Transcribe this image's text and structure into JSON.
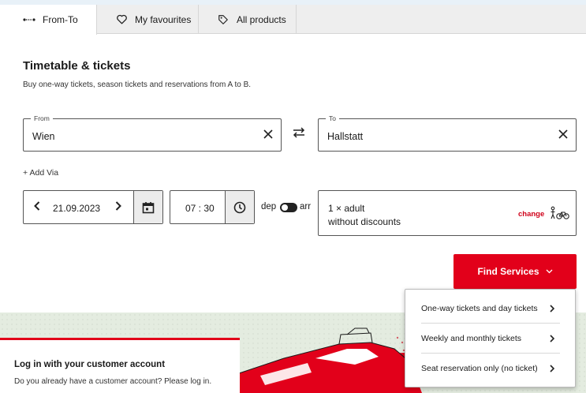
{
  "tabs": [
    {
      "label": "From-To",
      "icon": "route-dots-icon",
      "active": true
    },
    {
      "label": "My favourites",
      "icon": "heart-icon",
      "active": false
    },
    {
      "label": "All products",
      "icon": "tag-icon",
      "active": false
    }
  ],
  "heading": "Timetable & tickets",
  "subheading": "Buy one-way tickets, season tickets and reservations from A to B.",
  "from": {
    "legend": "From",
    "value": "Wien"
  },
  "to": {
    "legend": "To",
    "value": "Hallstatt"
  },
  "add_via": "+ Add Via",
  "date": {
    "value": "21.09.2023"
  },
  "time": {
    "value": "07 : 30"
  },
  "dep_label": "dep",
  "arr_label": "arr",
  "passengers": {
    "line1": "1 × adult",
    "line2": "without discounts",
    "change_label": "change"
  },
  "find_button": "Find Services",
  "login": {
    "title": "Log in with your customer account",
    "text": "Do you already have a customer account? Please log in."
  },
  "dropdown": [
    {
      "label": "One-way tickets and day tickets"
    },
    {
      "label": "Weekly and monthly tickets"
    },
    {
      "label": "Seat reservation only (no ticket)"
    }
  ],
  "colors": {
    "accent": "#e2001a",
    "tab_bg": "#eeeeee",
    "promo_bg": "#e4ece0"
  }
}
